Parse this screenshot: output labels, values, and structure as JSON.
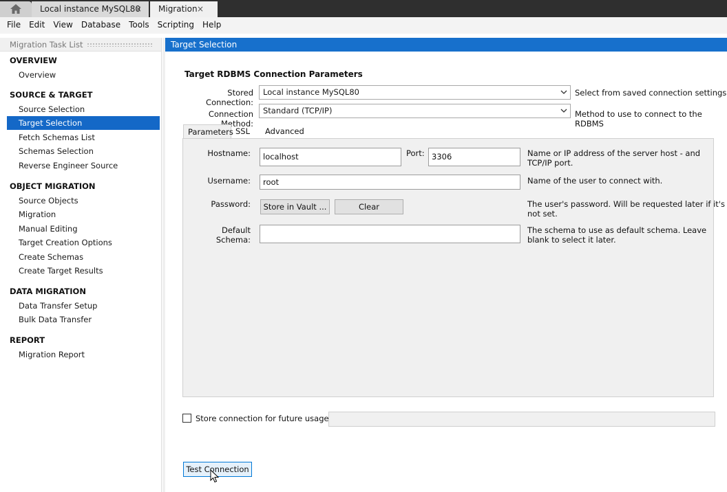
{
  "tabs": [
    {
      "label": "Local instance MySQL80",
      "close": "×"
    },
    {
      "label": "Migration",
      "close": "×"
    }
  ],
  "menu": [
    "File",
    "Edit",
    "View",
    "Database",
    "Tools",
    "Scripting",
    "Help"
  ],
  "sidebar": {
    "title": "Migration Task List",
    "sections": [
      {
        "title": "OVERVIEW",
        "items": [
          "Overview"
        ]
      },
      {
        "title": "SOURCE & TARGET",
        "items": [
          "Source Selection",
          "Target Selection",
          "Fetch Schemas List",
          "Schemas Selection",
          "Reverse Engineer Source"
        ]
      },
      {
        "title": "OBJECT MIGRATION",
        "items": [
          "Source Objects",
          "Migration",
          "Manual Editing",
          "Target Creation Options",
          "Create Schemas",
          "Create Target Results"
        ]
      },
      {
        "title": "DATA MIGRATION",
        "items": [
          "Data Transfer Setup",
          "Bulk Data Transfer"
        ]
      },
      {
        "title": "REPORT",
        "items": [
          "Migration Report"
        ]
      }
    ],
    "selected": "Target Selection"
  },
  "main": {
    "header": "Target Selection",
    "group_title": "Target RDBMS Connection Parameters",
    "stored_connection": {
      "label": "Stored Connection:",
      "value": "Local instance MySQL80",
      "description": "Select from saved connection settings"
    },
    "connection_method": {
      "label": "Connection Method:",
      "value": "Standard (TCP/IP)",
      "description": "Method to use to connect to the RDBMS"
    },
    "subtabs": [
      "Parameters",
      "SSL",
      "Advanced"
    ],
    "active_subtab": "Parameters",
    "hostname": {
      "label": "Hostname:",
      "value": "localhost"
    },
    "port": {
      "label": "Port:",
      "value": "3306"
    },
    "hostname_desc_1": "Name or IP address of the server host - and",
    "hostname_desc_2": "TCP/IP port.",
    "username": {
      "label": "Username:",
      "value": "root",
      "description": "Name of the user to connect with."
    },
    "password": {
      "label": "Password:",
      "store_button": "Store in Vault ...",
      "clear_button": "Clear",
      "desc_1": "The user's password. Will be requested later if it's",
      "desc_2": "not set."
    },
    "default_schema": {
      "label": "Default Schema:",
      "value": "",
      "desc_1": "The schema to use as default schema. Leave",
      "desc_2": "blank to select it later."
    },
    "store_connection": {
      "label": "Store connection for future usage as",
      "checked": false,
      "value": ""
    },
    "test_button": "Test Connection"
  },
  "colors": {
    "accent": "#1770cc",
    "selected": "#1468c7",
    "panel": "#f0f0f0"
  }
}
